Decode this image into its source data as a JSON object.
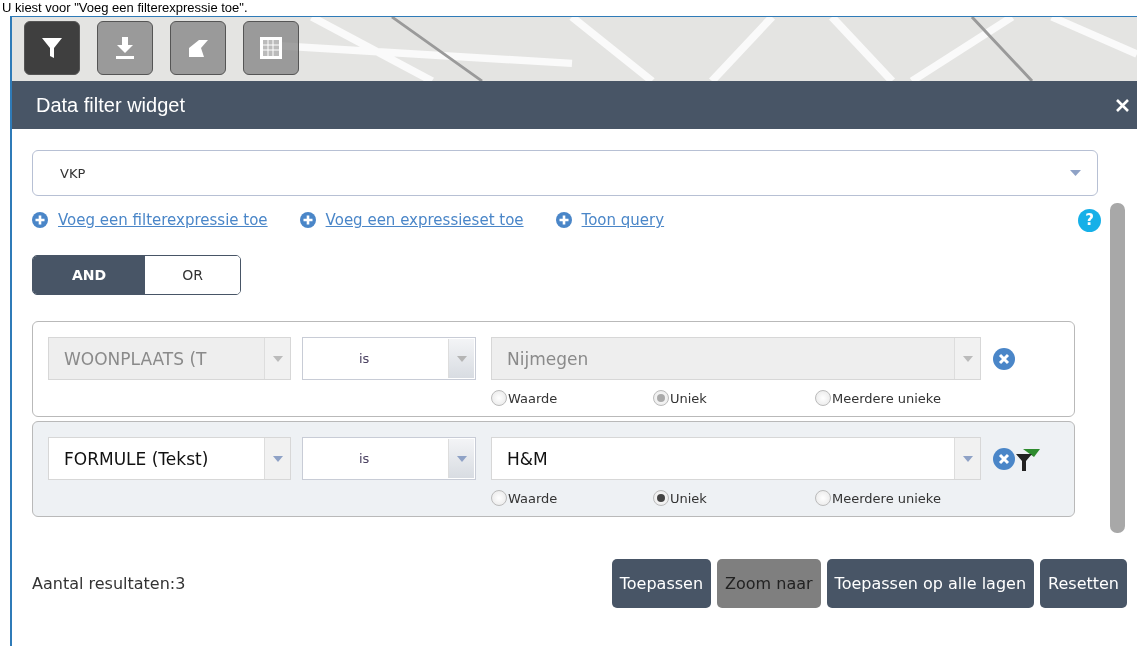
{
  "caption": "U kiest voor \"Voeg een filterexpressie toe\".",
  "toolbar": [
    {
      "kind": "filter",
      "selected": true
    },
    {
      "kind": "download",
      "selected": false
    },
    {
      "kind": "shape",
      "selected": false
    },
    {
      "kind": "grid",
      "selected": false
    }
  ],
  "widget": {
    "title": "Data filter widget",
    "layer": "VKP",
    "help": "?",
    "links": [
      {
        "label": "Voeg een filterexpressie toe"
      },
      {
        "label": "Voeg een expressieset toe"
      },
      {
        "label": "Toon query"
      }
    ],
    "logic": [
      {
        "label": "AND",
        "selected": true
      },
      {
        "label": "OR",
        "selected": false
      }
    ],
    "expressions": [
      {
        "disabled": true,
        "field": "WOONPLAATS (T",
        "operator": "is",
        "value": "Nijmegen",
        "filtered": false,
        "modes": [
          {
            "label": "Waarde",
            "selected": false
          },
          {
            "label": "Uniek",
            "selected": true
          },
          {
            "label": "Meerdere unieke",
            "selected": false
          }
        ]
      },
      {
        "disabled": false,
        "field": "FORMULE (Tekst)",
        "operator": "is",
        "value": "H&M",
        "filtered": true,
        "modes": [
          {
            "label": "Waarde",
            "selected": false
          },
          {
            "label": "Uniek",
            "selected": true
          },
          {
            "label": "Meerdere unieke",
            "selected": false
          }
        ]
      }
    ],
    "result": "Aantal resultaten:3",
    "buttons": [
      {
        "label": "Toepassen",
        "disabled": false
      },
      {
        "label": "Zoom naar",
        "disabled": true
      },
      {
        "label": "Toepassen op alle lagen",
        "disabled": false
      },
      {
        "label": "Resetten",
        "disabled": false
      }
    ]
  }
}
